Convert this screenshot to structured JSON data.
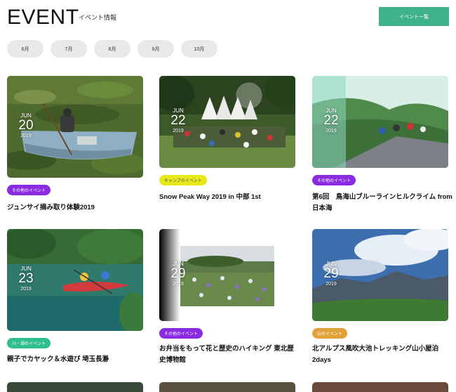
{
  "header": {
    "title": "EVENT",
    "subtitle": "イベント情報",
    "list_button": "イベント一覧"
  },
  "months": [
    "6月",
    "7月",
    "8月",
    "9月",
    "10月"
  ],
  "colors": {
    "accent": "#3fb28a",
    "tag_purple": "#8a2be2",
    "tag_yellow": "#e6ea1a",
    "tag_green": "#2fbf8f",
    "tag_orange": "#e2a23a"
  },
  "events": [
    {
      "month": "JUN",
      "day": "20",
      "year": "2019",
      "category": "その他のイベント",
      "title": "ジュンサイ摘み取り体験2019"
    },
    {
      "month": "JUN",
      "day": "22",
      "year": "2019",
      "category": "キャンプのイベント",
      "title": "Snow Peak Way 2019 in 中部 1st"
    },
    {
      "month": "JUN",
      "day": "22",
      "year": "2019",
      "category": "その他のイベント",
      "title": "第6回　鳥海山ブルーラインヒルクライム from日本海"
    },
    {
      "month": "JUN",
      "day": "23",
      "year": "2019",
      "category": "川・湖のイベント",
      "title": "親子でカヤック＆水遊び 埼玉長瀞"
    },
    {
      "month": "JUN",
      "day": "29",
      "year": "2019",
      "category": "その他のイベント",
      "title": "お弁当をもって花と歴史のハイキング 東北歴史博物館"
    },
    {
      "month": "JUN",
      "day": "29",
      "year": "2019",
      "category": "山のイベント",
      "title": "北アルプス風吹大池トレッキング山小屋泊 2days"
    }
  ]
}
